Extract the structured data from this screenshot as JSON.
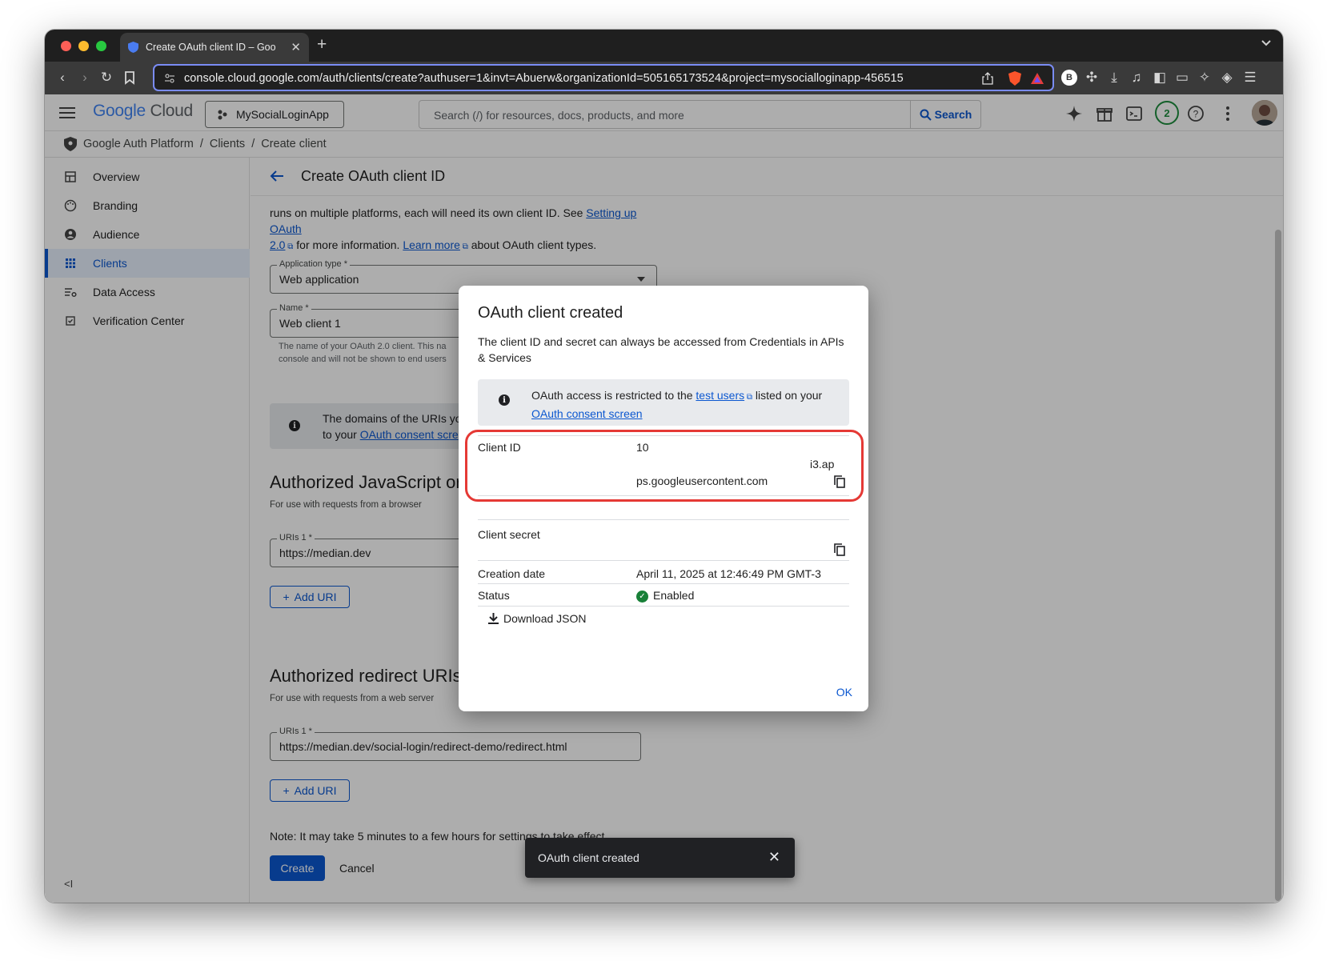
{
  "browser": {
    "tab_title": "Create OAuth client ID – Goo",
    "url": "console.cloud.google.com/auth/clients/create?authuser=1&invt=Abuerw&organizationId=505165173524&project=mysocialloginapp-456515"
  },
  "header": {
    "logo_google": "Google",
    "logo_cloud": "Cloud",
    "project": "MySocialLoginApp",
    "search_placeholder": "Search (/) for resources, docs, products, and more",
    "search_button": "Search",
    "notification_count": "2"
  },
  "breadcrumb": [
    "Google Auth Platform",
    "Clients",
    "Create client"
  ],
  "sidebar": {
    "items": [
      {
        "label": "Overview",
        "icon": "dashboard-icon"
      },
      {
        "label": "Branding",
        "icon": "palette-icon"
      },
      {
        "label": "Audience",
        "icon": "person-icon"
      },
      {
        "label": "Clients",
        "icon": "grid-icon",
        "active": true
      },
      {
        "label": "Data Access",
        "icon": "data-access-icon"
      },
      {
        "label": "Verification Center",
        "icon": "verification-icon"
      }
    ],
    "collapse_label": "<I"
  },
  "page": {
    "title": "Create OAuth client ID",
    "intro_1": "runs on multiple platforms, each will need its own client ID. See ",
    "intro_link_1a": "Setting up OAuth",
    "intro_link_1b": "2.0",
    "intro_2": " for more information. ",
    "intro_link_2": "Learn more",
    "intro_3": " about OAuth client types.",
    "app_type_label": "Application type *",
    "app_type_value": "Web application",
    "name_label": "Name *",
    "name_value": "Web client 1",
    "name_helper_1": "The name of your OAuth 2.0 client. This na",
    "name_helper_2": "console and will not be shown to end users",
    "info_1": "The domains of the URIs yo",
    "info_2": "to your ",
    "info_link": "OAuth consent scre",
    "js_title": "Authorized JavaScript or",
    "js_sub": "For use with requests from a browser",
    "js_uri_label": "URIs 1 *",
    "js_uri_value": "https://median.dev",
    "add_uri": "Add URI",
    "redirect_title": "Authorized redirect URIs",
    "redirect_sub": "For use with requests from a web server",
    "redirect_uri_label": "URIs 1 *",
    "redirect_uri_value": "https://median.dev/social-login/redirect-demo/redirect.html",
    "note": "Note: It may take 5 minutes to a few hours for settings to take effect",
    "create": "Create",
    "cancel": "Cancel"
  },
  "dialog": {
    "title": "OAuth client created",
    "desc": "The client ID and secret can always be accessed from Credentials in APIs & Services",
    "info_1": "OAuth access is restricted to the ",
    "info_link_1": "test users",
    "info_2": " listed on your ",
    "info_link_2": "OAuth consent screen",
    "client_id_label": "Client ID",
    "client_id_line1": "10",
    "client_id_line2": "i3.ap",
    "client_id_line3": "ps.googleusercontent.com",
    "client_secret_label": "Client secret",
    "creation_label": "Creation date",
    "creation_value": "April 11, 2025 at 12:46:49 PM GMT-3",
    "status_label": "Status",
    "status_value": "Enabled",
    "download": "Download JSON",
    "ok": "OK"
  },
  "toast": {
    "text": "OAuth client created"
  },
  "colors": {
    "accent": "#0b57d0",
    "highlight": "#e53935",
    "status_green": "#188038"
  }
}
